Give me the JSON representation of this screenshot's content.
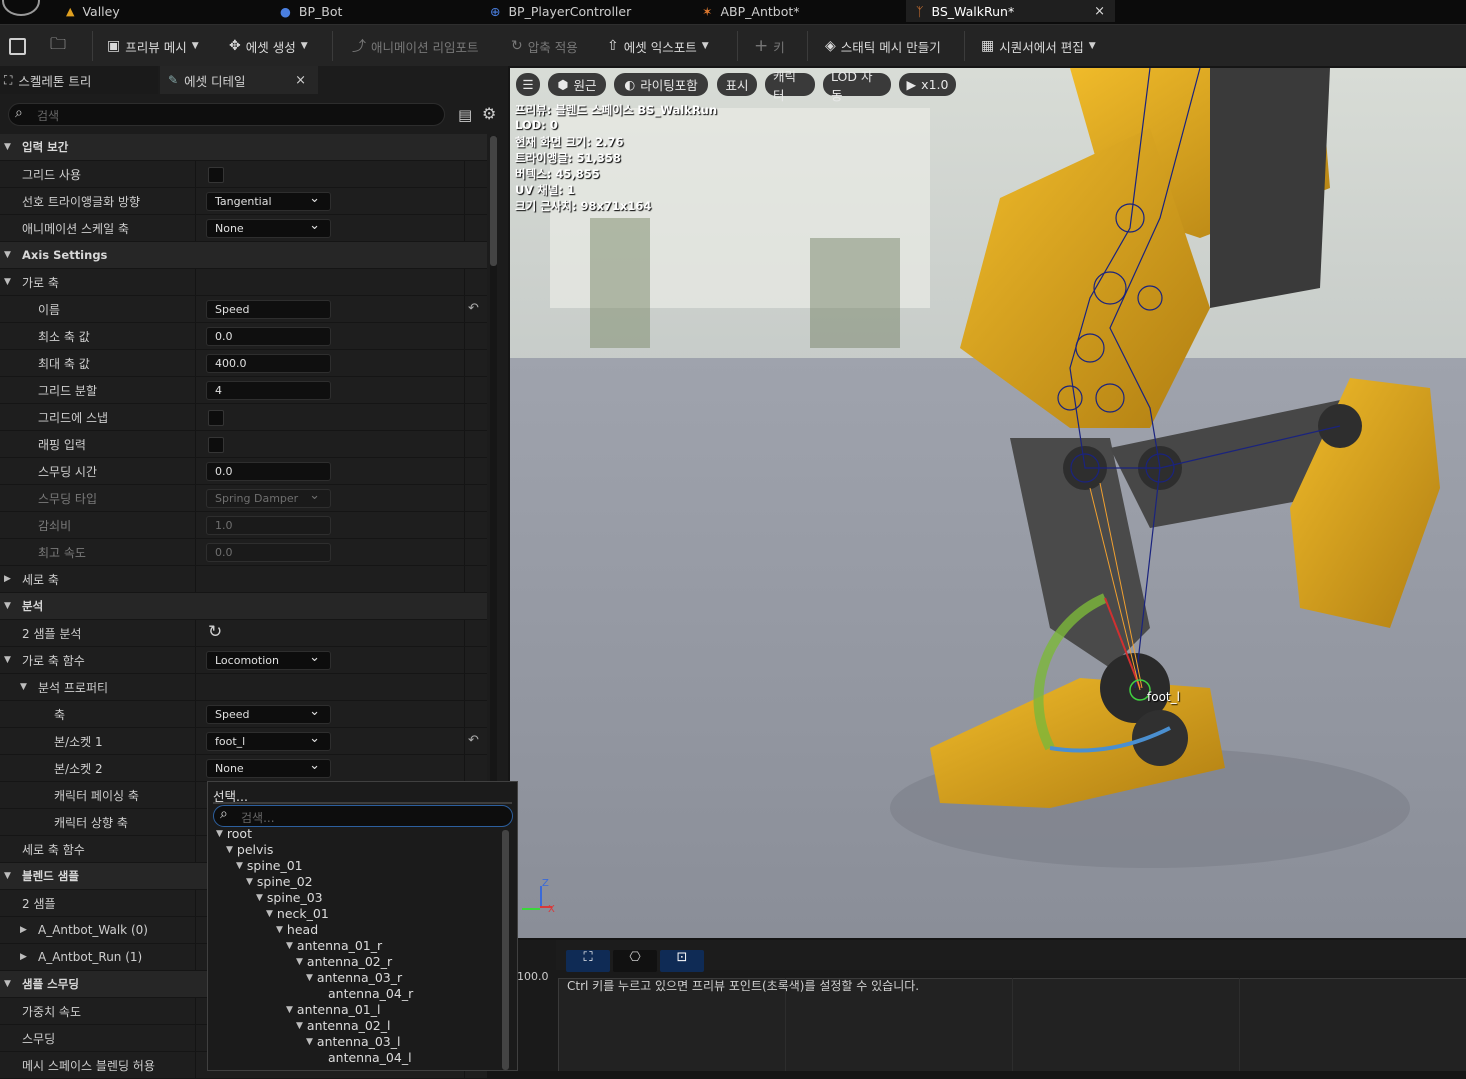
{
  "tabs": [
    {
      "label": "Valley",
      "icon": "level-icon"
    },
    {
      "label": "BP_Bot",
      "icon": "pawn-icon"
    },
    {
      "label": "BP_PlayerController",
      "icon": "gamepad-icon"
    },
    {
      "label": "ABP_Antbot*",
      "icon": "anim-blueprint-icon"
    },
    {
      "label": "BS_WalkRun*",
      "icon": "blendspace-icon"
    }
  ],
  "toolbar": {
    "preview_mesh": "프리뷰 메시",
    "create_asset": "에셋 생성",
    "reimport": "애니메이션 리임포트",
    "apply_compression": "압축 적용",
    "export_asset": "에셋 익스포트",
    "key": "키",
    "make_static_mesh": "스태틱 메시 만들기",
    "edit_in_sequencer": "시퀀서에서 편집"
  },
  "panel": {
    "tab_skeleton": "스켈레톤 트리",
    "tab_details": "에셋 디테일",
    "search_placeholder": "검색"
  },
  "props": [
    {
      "label": "입력 보간",
      "cat": true,
      "tri": "down",
      "indent": 0
    },
    {
      "label": "그리드 사용",
      "indent": 1,
      "kind": "check"
    },
    {
      "label": "선호 트라이앵글화 방향",
      "indent": 1,
      "kind": "dd",
      "value": "Tangential"
    },
    {
      "label": "애니메이션 스케일 축",
      "indent": 1,
      "kind": "dd",
      "value": "None"
    },
    {
      "label": "Axis Settings",
      "cat": true,
      "tri": "down",
      "indent": 0
    },
    {
      "label": "가로 축",
      "tri": "down",
      "indent": 0
    },
    {
      "label": "이름",
      "indent": 2,
      "kind": "text",
      "value": "Speed",
      "reset": true
    },
    {
      "label": "최소 축 값",
      "indent": 2,
      "kind": "text",
      "value": "0.0"
    },
    {
      "label": "최대 축 값",
      "indent": 2,
      "kind": "text",
      "value": "400.0"
    },
    {
      "label": "그리드 분할",
      "indent": 2,
      "kind": "text",
      "value": "4"
    },
    {
      "label": "그리드에 스냅",
      "indent": 2,
      "kind": "check"
    },
    {
      "label": "래핑 입력",
      "indent": 2,
      "kind": "check"
    },
    {
      "label": "스무딩 시간",
      "indent": 2,
      "kind": "text",
      "value": "0.0"
    },
    {
      "label": "스무딩 타입",
      "indent": 2,
      "kind": "dd",
      "value": "Spring Damper",
      "dis": true
    },
    {
      "label": "감쇠비",
      "indent": 2,
      "kind": "text",
      "value": "1.0",
      "dis": true
    },
    {
      "label": "최고 속도",
      "indent": 2,
      "kind": "text",
      "value": "0.0",
      "dis": true
    },
    {
      "label": "세로 축",
      "tri": "right",
      "indent": 0
    },
    {
      "label": "분석",
      "cat": true,
      "tri": "down",
      "indent": 0
    },
    {
      "label": "2 샘플 분석",
      "indent": 1,
      "kind": "refresh"
    },
    {
      "label": "가로 축 함수",
      "tri": "down",
      "indent": 0,
      "kind": "dd",
      "value": "Locomotion"
    },
    {
      "label": "분석 프로퍼티",
      "tri": "down",
      "indent": 1
    },
    {
      "label": "축",
      "indent": 3,
      "kind": "dd",
      "value": "Speed"
    },
    {
      "label": "본/소켓 1",
      "indent": 3,
      "kind": "dd",
      "value": "foot_l",
      "reset": true
    },
    {
      "label": "본/소켓 2",
      "indent": 3,
      "kind": "dd",
      "value": "None"
    },
    {
      "label": "캐릭터 페이싱 축",
      "indent": 3
    },
    {
      "label": "캐릭터 상향 축",
      "indent": 3
    },
    {
      "label": "세로 축 함수",
      "indent": 1
    },
    {
      "label": "블렌드 샘플",
      "cat": true,
      "tri": "down",
      "indent": 0
    },
    {
      "label": "2 샘플",
      "indent": 1
    },
    {
      "label": "A_Antbot_Walk (0)",
      "tri": "right",
      "indent": 1
    },
    {
      "label": "A_Antbot_Run (1)",
      "tri": "right",
      "indent": 1
    },
    {
      "label": "샘플 스무딩",
      "cat": true,
      "tri": "down",
      "indent": 0
    },
    {
      "label": "가중치 속도",
      "indent": 1
    },
    {
      "label": "스무딩",
      "indent": 1
    },
    {
      "label": "메시 스페이스 블렌딩 허용",
      "indent": 1
    }
  ],
  "popup": {
    "title": "선택...",
    "search_placeholder": "검색...",
    "tree": [
      {
        "name": "root",
        "depth": 0
      },
      {
        "name": "pelvis",
        "depth": 1
      },
      {
        "name": "spine_01",
        "depth": 2
      },
      {
        "name": "spine_02",
        "depth": 3
      },
      {
        "name": "spine_03",
        "depth": 4
      },
      {
        "name": "neck_01",
        "depth": 5
      },
      {
        "name": "head",
        "depth": 6
      },
      {
        "name": "antenna_01_r",
        "depth": 7
      },
      {
        "name": "antenna_02_r",
        "depth": 8
      },
      {
        "name": "antenna_03_r",
        "depth": 9
      },
      {
        "name": "antenna_04_r",
        "depth": 10
      },
      {
        "name": "antenna_01_l",
        "depth": 7
      },
      {
        "name": "antenna_02_l",
        "depth": 8
      },
      {
        "name": "antenna_03_l",
        "depth": 9
      },
      {
        "name": "antenna_04_l",
        "depth": 10
      }
    ]
  },
  "viewport": {
    "buttons": {
      "perspective": "원근",
      "lit": "라이팅포함",
      "show": "표시",
      "character": "캐릭터",
      "lod": "LOD 자동",
      "speed": "x1.0"
    },
    "overlay": [
      "프리뷰: 블렌드 스페이스 BS_WalkRun",
      "LOD: 0",
      "현재 화면 크기: 2.76",
      "트라이앵글: 51,358",
      "버텍스: 45,855",
      "UV 채널: 1",
      "크기 근사치: 98x71x164"
    ],
    "bone_label": "foot_l",
    "axis_x": "X",
    "axis_z": "Z"
  },
  "bottom": {
    "axis_value": "100.0",
    "hint": "Ctrl 키를 누르고 있으면 프리뷰 포인트(초록색)를 설정할 수 있습니다."
  },
  "colors": {
    "accent": "#1e3a5c",
    "robot_yellow": "#d9a21b",
    "bone_blue": "#1a237e"
  }
}
